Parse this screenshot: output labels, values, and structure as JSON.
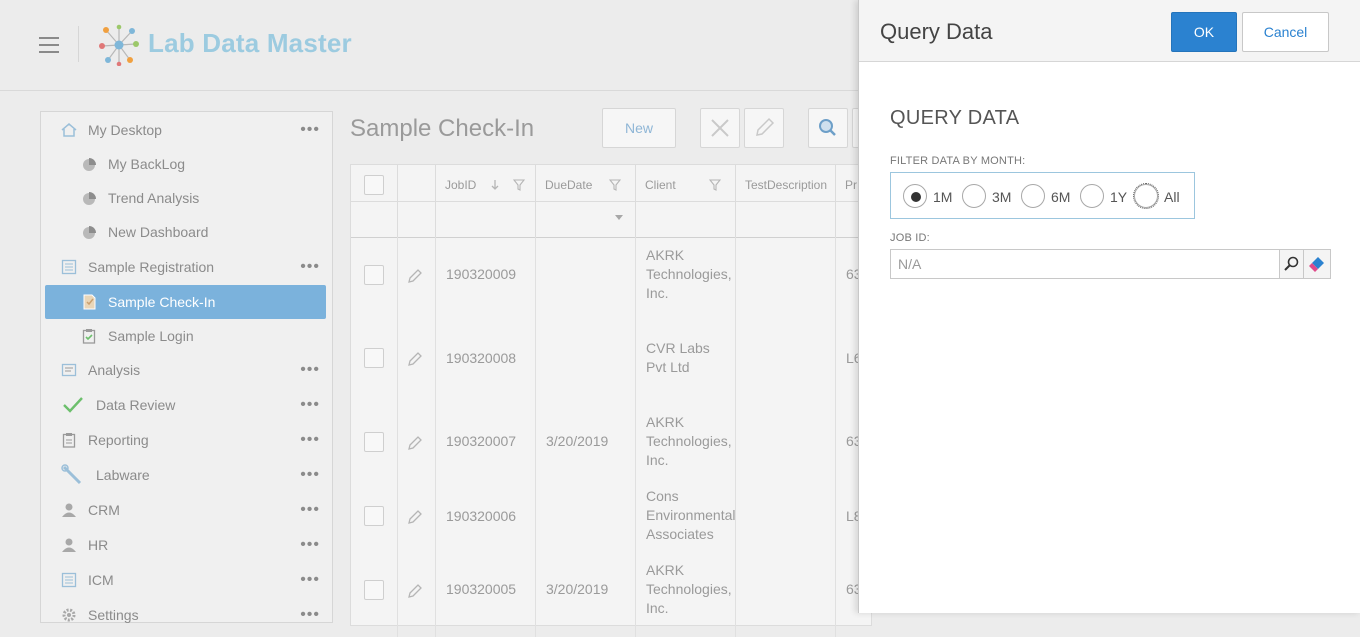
{
  "header": {
    "app_title": "Lab Data Master"
  },
  "sidebar": {
    "items": [
      {
        "label": "My Desktop",
        "icon": "home-icon",
        "more": "•••"
      },
      {
        "label": "My BackLog",
        "icon": "chart-icon"
      },
      {
        "label": "Trend Analysis",
        "icon": "chart-icon"
      },
      {
        "label": "New Dashboard",
        "icon": "chart-icon"
      },
      {
        "label": "Sample Registration",
        "icon": "form-icon",
        "more": "•••"
      },
      {
        "label": "Sample Check-In",
        "icon": "check-in-icon",
        "selected": true
      },
      {
        "label": "Sample Login",
        "icon": "clipboard-check-icon"
      },
      {
        "label": "Analysis",
        "icon": "analysis-icon",
        "more": "•••"
      },
      {
        "label": "Data Review",
        "icon": "checkmark-icon",
        "more": "•••"
      },
      {
        "label": "Reporting",
        "icon": "report-icon",
        "more": "•••"
      },
      {
        "label": "Labware",
        "icon": "wrench-icon",
        "more": "•••"
      },
      {
        "label": "CRM",
        "icon": "person-icon",
        "more": "•••"
      },
      {
        "label": "HR",
        "icon": "person-icon",
        "more": "•••"
      },
      {
        "label": "ICM",
        "icon": "form-icon",
        "more": "•••"
      },
      {
        "label": "Settings",
        "icon": "gear-icon",
        "more": "•••"
      }
    ]
  },
  "main": {
    "page_title": "Sample Check-In",
    "toolbar": {
      "new_label": "New"
    },
    "grid": {
      "columns": [
        "JobID",
        "DueDate",
        "Client",
        "TestDescription",
        "Pr"
      ],
      "rows": [
        {
          "job_id": "190320009",
          "due_date": "",
          "client": [
            "AKRK",
            "Technologies,",
            "Inc."
          ],
          "pr": "63"
        },
        {
          "job_id": "190320008",
          "due_date": "",
          "client": [
            "CVR Labs",
            "Pvt Ltd"
          ],
          "pr": "L6"
        },
        {
          "job_id": "190320007",
          "due_date": "3/20/2019",
          "client": [
            "AKRK",
            "Technologies,",
            "Inc."
          ],
          "pr": "63"
        },
        {
          "job_id": "190320006",
          "due_date": "",
          "client": [
            "Cons",
            "Environmental",
            "Associates"
          ],
          "pr": "L8"
        },
        {
          "job_id": "190320005",
          "due_date": "3/20/2019",
          "client": [
            "AKRK",
            "Technologies,",
            "Inc."
          ],
          "pr": "63"
        }
      ]
    }
  },
  "dialog": {
    "title": "Query Data",
    "ok_label": "OK",
    "cancel_label": "Cancel",
    "section_title": "QUERY DATA",
    "filter_label": "FILTER DATA BY MONTH:",
    "filter_options": [
      "1M",
      "3M",
      "6M",
      "1Y",
      "All"
    ],
    "filter_selected": "1M",
    "job_id_label": "JOB ID:",
    "job_id_placeholder": "N/A"
  },
  "colors": {
    "accent": "#2b82d0",
    "selected_nav": "#7bb2dc",
    "logo_text": "#9ccbe0"
  }
}
